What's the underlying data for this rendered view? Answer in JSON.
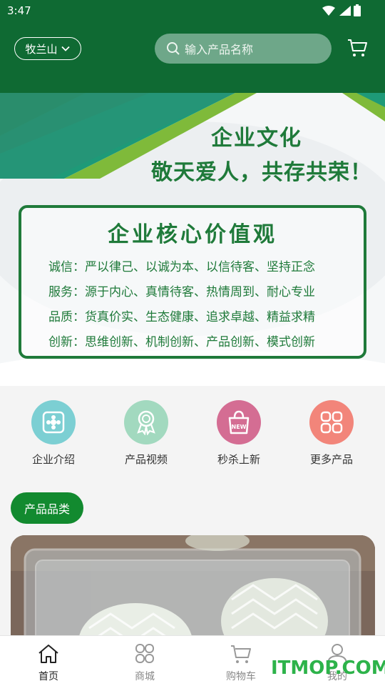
{
  "status_bar": {
    "time": "3:47"
  },
  "header": {
    "location": "牧兰山",
    "search_placeholder": "输入产品名称"
  },
  "banner": {
    "title": "企业文化",
    "subtitle": "敬天爱人，共存共荣！",
    "values_heading": "企业核心价值观",
    "values": [
      "诚信：严以律己、以诚为本、以信待客、坚持正念",
      "服务：源于内心、真情待客、热情周到、耐心专业",
      "品质：货真价实、生态健康、追求卓越、精益求精",
      "创新：思维创新、机制创新、产品创新、模式创新"
    ]
  },
  "quick_nav": [
    {
      "label": "企业介绍",
      "icon": "company-icon",
      "color": "#7ccfd3"
    },
    {
      "label": "产品视频",
      "icon": "award-icon",
      "color": "#a2d9bf"
    },
    {
      "label": "秒杀上新",
      "icon": "new-bag-icon",
      "color": "#d46d93"
    },
    {
      "label": "更多产品",
      "icon": "grid-icon",
      "color": "#f2857a"
    }
  ],
  "category_chip": "产品品类",
  "bottom_nav": [
    {
      "label": "首页",
      "icon": "home-icon",
      "active": true
    },
    {
      "label": "商城",
      "icon": "mall-icon",
      "active": false
    },
    {
      "label": "购物车",
      "icon": "cart-icon",
      "active": false
    },
    {
      "label": "我的",
      "icon": "user-icon",
      "active": false
    }
  ],
  "watermark": "ITMOP.COM",
  "colors": {
    "primary": "#0f6a33",
    "accent": "#128a2f",
    "banner_green": "#1f7a3a"
  }
}
